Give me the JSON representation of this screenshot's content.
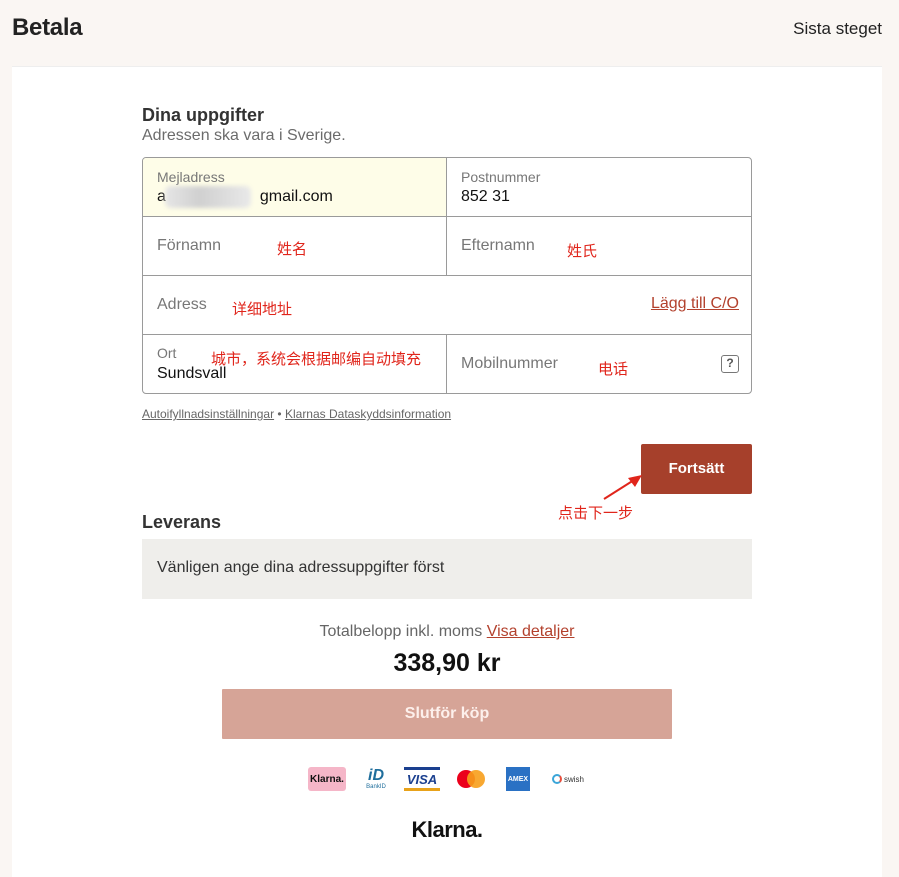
{
  "header": {
    "title": "Betala",
    "step": "Sista steget"
  },
  "details": {
    "title": "Dina uppgifter",
    "subtitle": "Adressen ska vara i Sverige.",
    "email_label": "Mejladress",
    "email_value_start": "a",
    "email_value_end": "gmail.com",
    "postal_label": "Postnummer",
    "postal_value": "852 31",
    "firstname_placeholder": "Förnamn",
    "lastname_placeholder": "Efternamn",
    "address_placeholder": "Adress",
    "add_co_link": "Lägg till C/O",
    "city_label": "Ort",
    "city_value": "Sundsvall",
    "mobile_placeholder": "Mobilnummer",
    "help_glyph": "?"
  },
  "annotations": {
    "firstname": "姓名",
    "lastname": "姓氏",
    "address": "详细地址",
    "city": "城市，系统会根据邮编自动填充",
    "mobile": "电话",
    "click_next": "点击下一步"
  },
  "footer_links": {
    "autofill": "Autoifyllnadsinställningar",
    "separator": "•",
    "privacy": "Klarnas Dataskyddsinformation"
  },
  "continue_button": "Fortsätt",
  "delivery": {
    "title": "Leverans",
    "message": "Vänligen ange dina adressuppgifter först"
  },
  "total": {
    "label": "Totalbelopp inkl. moms",
    "details_link": "Visa detaljer",
    "amount": "338,90 kr"
  },
  "finish_button": "Slutför köp",
  "payment_logos": {
    "klarna": "Klarna.",
    "bankid": "BankID",
    "visa": "VISA",
    "amex": "AMEX",
    "swish": "swish"
  },
  "brand": "Klarna.",
  "colors": {
    "accent": "#a6402b",
    "finish_disabled": "#d6a497",
    "annotation": "#e0251b",
    "email_highlight": "#fefde8"
  }
}
